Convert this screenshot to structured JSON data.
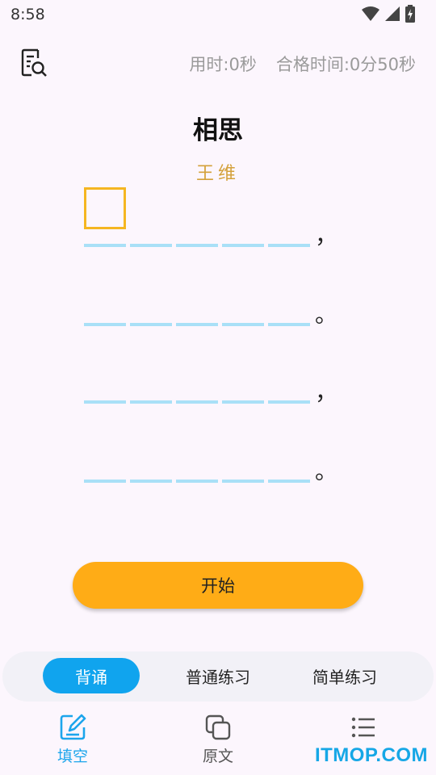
{
  "status": {
    "time": "8:58"
  },
  "header": {
    "used_time": "用时:0秒",
    "pass_time": "合格时间:0分50秒"
  },
  "poem": {
    "title": "相思",
    "author": "王维",
    "lines": [
      {
        "blanks": 5,
        "punct": "，"
      },
      {
        "blanks": 5,
        "punct": "。"
      },
      {
        "blanks": 5,
        "punct": "，"
      },
      {
        "blanks": 5,
        "punct": "。"
      }
    ]
  },
  "start_button": {
    "label": "开始"
  },
  "modes": [
    {
      "label": "背诵",
      "active": true
    },
    {
      "label": "普通练习",
      "active": false
    },
    {
      "label": "简单练习",
      "active": false
    }
  ],
  "nav": [
    {
      "label": "填空",
      "icon": "edit-icon",
      "active": true
    },
    {
      "label": "原文",
      "icon": "copy-icon",
      "active": false
    },
    {
      "label": "",
      "icon": "list-icon",
      "active": false
    }
  ],
  "watermark": "ITMOP.COM",
  "colors": {
    "accent": "#10a4ee",
    "start": "#ffac16",
    "author": "#d4a13a",
    "blank": "#a9e0f7",
    "cursor": "#f5b621"
  }
}
